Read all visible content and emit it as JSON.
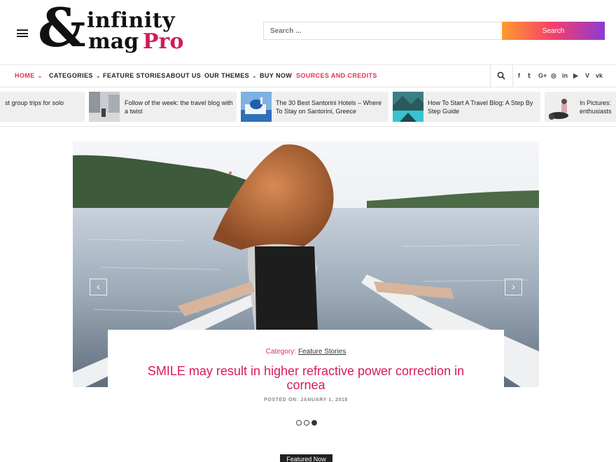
{
  "header": {
    "logo": {
      "amp": "&",
      "line1": "infinity",
      "line2a": "mag",
      "line2b": "Pro"
    },
    "search_placeholder": "Search ...",
    "search_button": "Search"
  },
  "nav": {
    "items": [
      {
        "label": "HOME",
        "dropdown": true,
        "active": true
      },
      {
        "label": "CATEGORIES",
        "dropdown": true
      },
      {
        "label": "FEATURE STORIES"
      },
      {
        "label": "ABOUT US"
      },
      {
        "label": "OUR THEMES",
        "dropdown": true
      },
      {
        "label": "BUY NOW"
      },
      {
        "label": "SOURCES AND CREDITS",
        "accent": true
      }
    ],
    "chevron": "⌄",
    "social": [
      "f",
      "𝕥",
      "G+",
      "◎",
      "in",
      "▶",
      "V",
      "vk"
    ],
    "social_names": [
      "facebook-icon",
      "twitter-icon",
      "google-plus-icon",
      "instagram-icon",
      "linkedin-icon",
      "youtube-icon",
      "vimeo-icon",
      "vk-icon"
    ]
  },
  "ticker": [
    {
      "title": "st group trips for solo"
    },
    {
      "title": "Follow of the week: the travel blog with a twist"
    },
    {
      "title": "The 30 Best Santorini Hotels – Where To Stay on Santorini, Greece"
    },
    {
      "title": "How To Start A Travel Blog: A Step By Step Guide"
    },
    {
      "title": "In Pictures: enthusiasts"
    }
  ],
  "slider": {
    "category_label": "Category:",
    "category": "Feature Stories",
    "title": "SMILE may result in higher refractive power correction in cornea",
    "posted": "POSTED ON: JANUARY 1, 2018",
    "prev": "‹",
    "next": "›",
    "slides": 3,
    "active_slide": 3
  },
  "featured_tag": "Featured Now",
  "colors": {
    "accent": "#e4304f",
    "title": "#d8185e",
    "logo_pro": "#d11b5c"
  }
}
